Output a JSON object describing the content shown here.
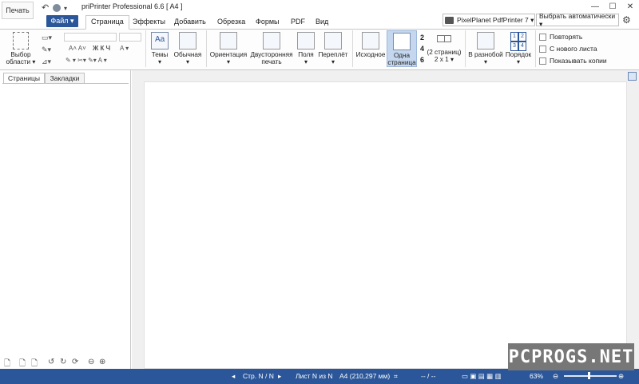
{
  "app": {
    "title": "priPrinter Professional 6.6 [ A4 ]",
    "print_label": "Печать"
  },
  "tabs": {
    "file": "Файл ▾",
    "items": [
      "Страница",
      "Эффекты",
      "Добавить",
      "Обрезка",
      "Формы",
      "PDF",
      "Вид"
    ]
  },
  "printer": {
    "name": "PixelPlanet PdfPrinter 7 ▾",
    "auto": "Выбрать автоматически ▾"
  },
  "ribbon": {
    "select_area": "Выбор области ▾",
    "themes": "Темы",
    "normal": "Обычная",
    "orientation": "Ориентация",
    "duplex": "Двусторонняя печать",
    "margins": "Поля",
    "binding": "Переплёт",
    "original": "Исходное",
    "one_page": "Одна страница",
    "two_pages": "(2 страниц) 2 x 1 ▾",
    "nup_numbers": [
      "2",
      "4",
      "6"
    ],
    "scatter": "В разнобой ▾",
    "order": "Порядок",
    "order_digits": [
      "1",
      "2",
      "3",
      "4"
    ],
    "repeat": "Повторять",
    "new_sheet": "С нового листа",
    "show_copies": "Показывать копии"
  },
  "panel": {
    "tab_pages": "Страницы",
    "tab_bookmarks": "Закладки"
  },
  "status": {
    "page": "Стр. N / N",
    "sheet": "Лист N из N",
    "size": "A4 (210,297 мм)",
    "coords": "-- / --",
    "zoom": "63%"
  },
  "watermark": "PCPROGS.NET",
  "colors": {
    "accent": "#2b579a",
    "active_button": "#c5d7ee"
  }
}
